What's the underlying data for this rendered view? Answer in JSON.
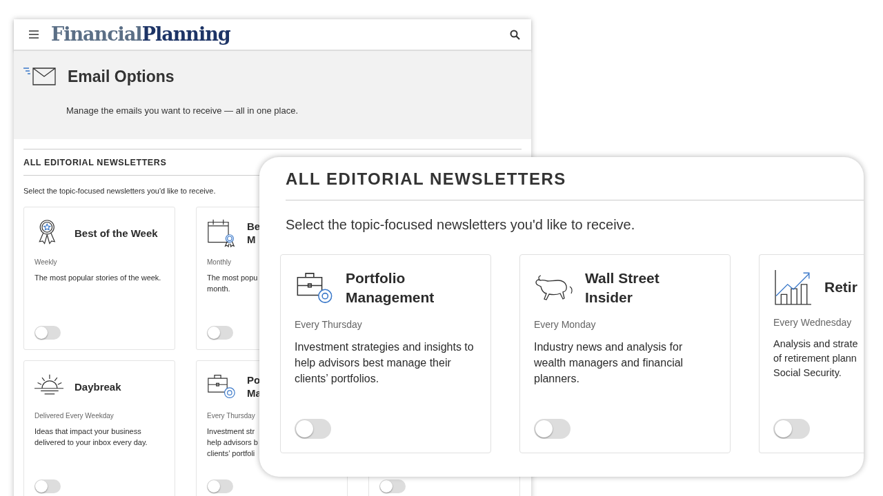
{
  "page": {
    "logo_parts": [
      "Financial",
      "Planning"
    ],
    "title": "Email Options",
    "subtitle": "Manage the emails you want to receive — all in one place.",
    "section_heading": "ALL EDITORIAL NEWSLETTERS",
    "section_intro": "Select the topic-focused newsletters you'd like to receive.",
    "cards": [
      {
        "title_lines": [
          "Best of the Week"
        ],
        "frequency": "Weekly",
        "description_lines": [
          "The most popular stories of the week."
        ],
        "on": false
      },
      {
        "title_lines": [
          "Be",
          "M"
        ],
        "frequency": "Monthly",
        "description_lines": [
          "The most popu",
          "month."
        ],
        "on": false
      },
      {
        "title_lines": [
          "Daybreak"
        ],
        "frequency": "Delivered Every Weekday",
        "description_lines": [
          "Ideas that impact your business delivered to your inbox every day."
        ],
        "on": false
      },
      {
        "title_lines": [
          "Po",
          "Ma"
        ],
        "frequency": "Every Thursday",
        "description_lines": [
          "Investment str",
          "help advisors b",
          "clients’ portfoli"
        ],
        "on": false
      },
      {
        "on": false
      }
    ]
  },
  "zoom_panel": {
    "section_heading": "ALL EDITORIAL NEWSLETTERS",
    "section_intro": "Select the topic-focused newsletters you'd like to receive.",
    "cards": [
      {
        "title_lines": [
          "Portfolio Management"
        ],
        "frequency": "Every Thursday",
        "description_lines": [
          "Investment strategies and insights to help advisors best manage their clients’ portfolios."
        ],
        "on": false
      },
      {
        "title_lines": [
          "Wall Street Insider"
        ],
        "frequency": "Every Monday",
        "description_lines": [
          "Industry news and analysis for wealth managers and financial planners."
        ],
        "on": false
      },
      {
        "title_lines": [
          "Retir"
        ],
        "frequency": "Every Wednesday",
        "description_lines": [
          "Analysis and strate",
          "of retirement plann",
          "Social Security."
        ],
        "on": false
      }
    ]
  }
}
